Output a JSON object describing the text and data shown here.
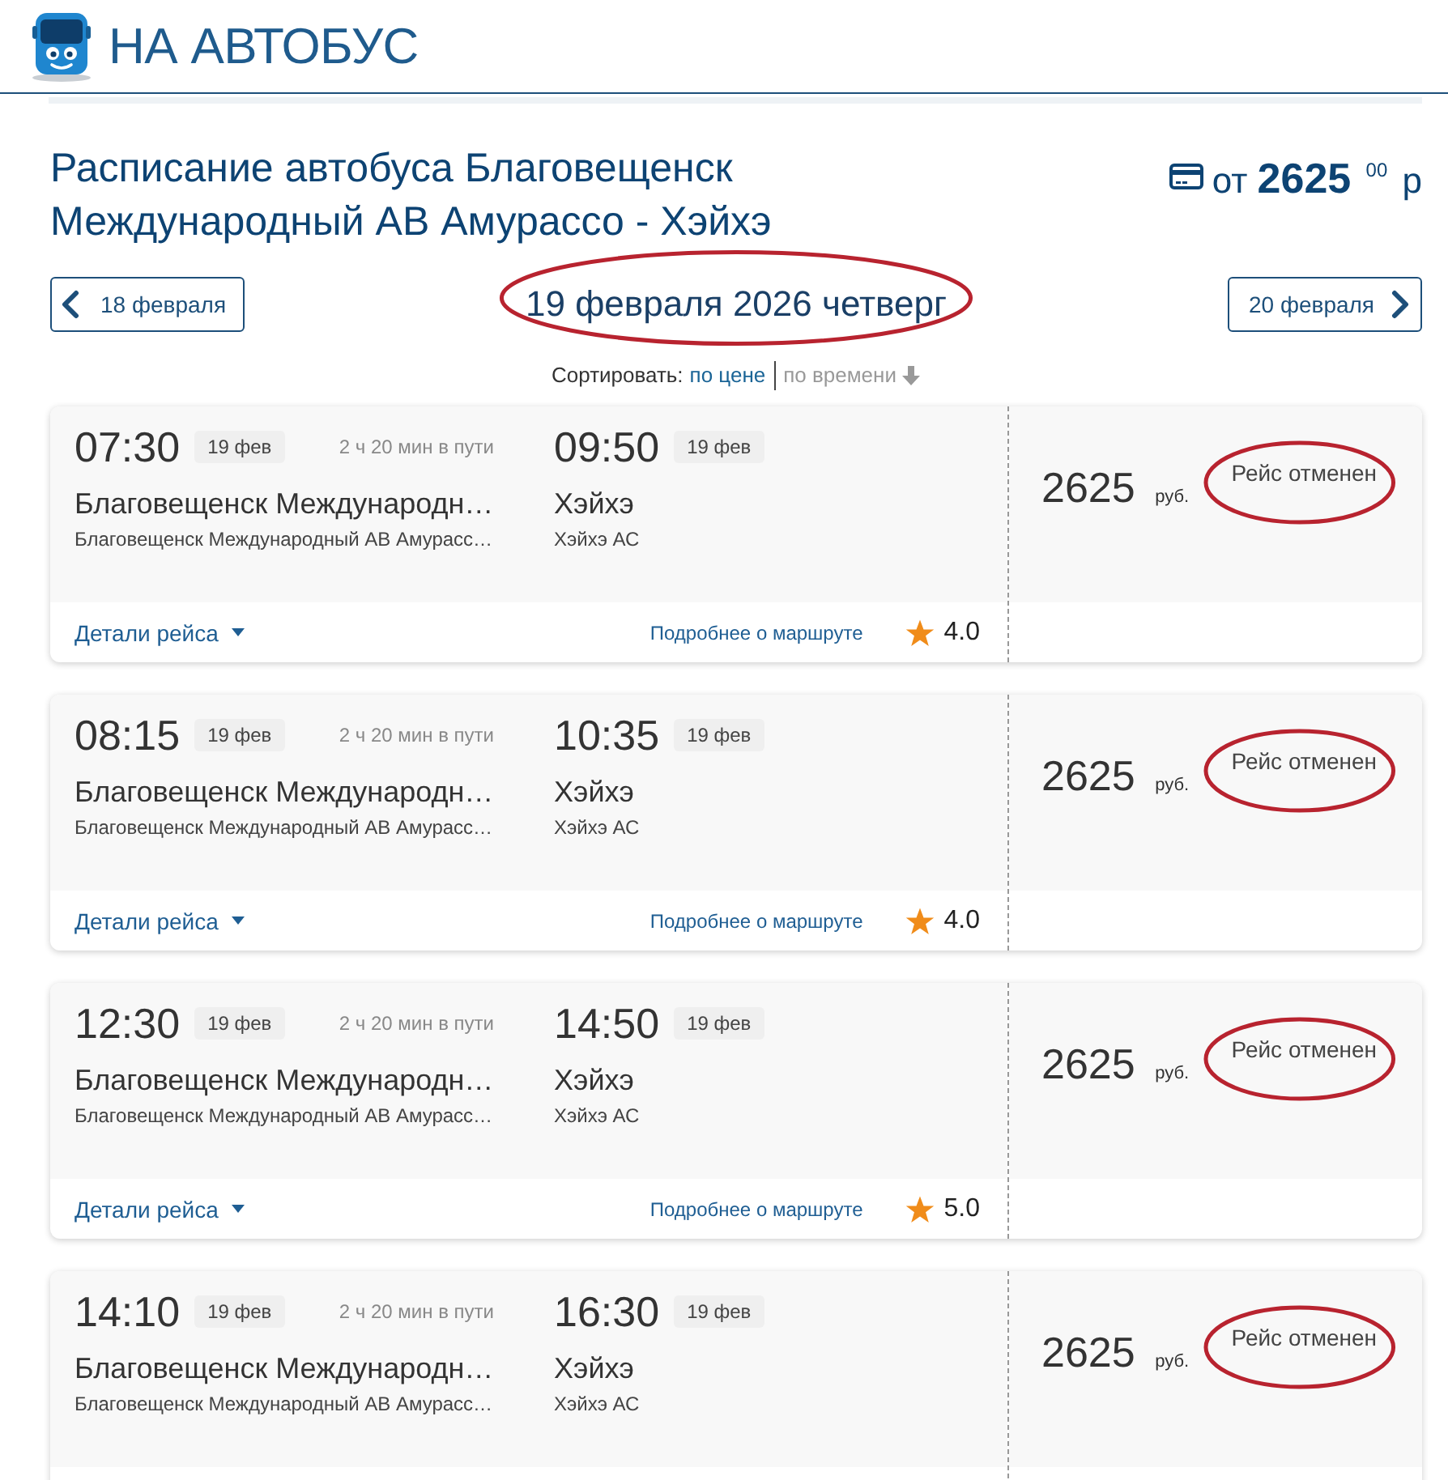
{
  "header": {
    "site_name": "НА АВТОБУС"
  },
  "page": {
    "title": "Расписание автобуса Благовещенск Международный АВ Амурассо - Хэйхэ",
    "price": {
      "prefix": "от",
      "amount": "2625",
      "cents": "00",
      "currency": "р"
    }
  },
  "date_nav": {
    "prev": "18 февраля",
    "current": "19 февраля 2026 четверг",
    "circled": true,
    "next": "20 февраля"
  },
  "sort": {
    "label": "Сортировать:",
    "options": [
      {
        "label": "по цене",
        "selected": false
      },
      {
        "label": "по времени",
        "selected": true
      }
    ]
  },
  "trips": [
    {
      "depart_time": "07:30",
      "depart_date": "19 фев",
      "duration": "2 ч 20 мин в пути",
      "arrive_time": "09:50",
      "arrive_date": "19 фев",
      "from_name": "Благовещенск Международн…",
      "from_station": "Благовещенск Международный АВ Амурасс…",
      "to_name": "Хэйхэ",
      "to_station": "Хэйхэ АС",
      "price": "2625",
      "currency": "руб.",
      "status": "Рейс отменен",
      "status_circled": true,
      "details": "Детали рейса",
      "more": "Подробнее о маршруте",
      "rating": "4.0"
    },
    {
      "depart_time": "08:15",
      "depart_date": "19 фев",
      "duration": "2 ч 20 мин в пути",
      "arrive_time": "10:35",
      "arrive_date": "19 фев",
      "from_name": "Благовещенск Международн…",
      "from_station": "Благовещенск Международный АВ Амурасс…",
      "to_name": "Хэйхэ",
      "to_station": "Хэйхэ АС",
      "price": "2625",
      "currency": "руб.",
      "status": "Рейс отменен",
      "status_circled": true,
      "details": "Детали рейса",
      "more": "Подробнее о маршруте",
      "rating": "4.0"
    },
    {
      "depart_time": "12:30",
      "depart_date": "19 фев",
      "duration": "2 ч 20 мин в пути",
      "arrive_time": "14:50",
      "arrive_date": "19 фев",
      "from_name": "Благовещенск Международн…",
      "from_station": "Благовещенск Международный АВ Амурасс…",
      "to_name": "Хэйхэ",
      "to_station": "Хэйхэ АС",
      "price": "2625",
      "currency": "руб.",
      "status": "Рейс отменен",
      "status_circled": true,
      "details": "Детали рейса",
      "more": "Подробнее о маршруте",
      "rating": "5.0"
    },
    {
      "depart_time": "14:10",
      "depart_date": "19 фев",
      "duration": "2 ч 20 мин в пути",
      "arrive_time": "16:30",
      "arrive_date": "19 фев",
      "from_name": "Благовещенск Международн…",
      "from_station": "Благовещенск Международный АВ Амурасс…",
      "to_name": "Хэйхэ",
      "to_station": "Хэйхэ АС",
      "price": "2625",
      "currency": "руб.",
      "status": "Рейс отменен",
      "status_circled": true
    }
  ]
}
